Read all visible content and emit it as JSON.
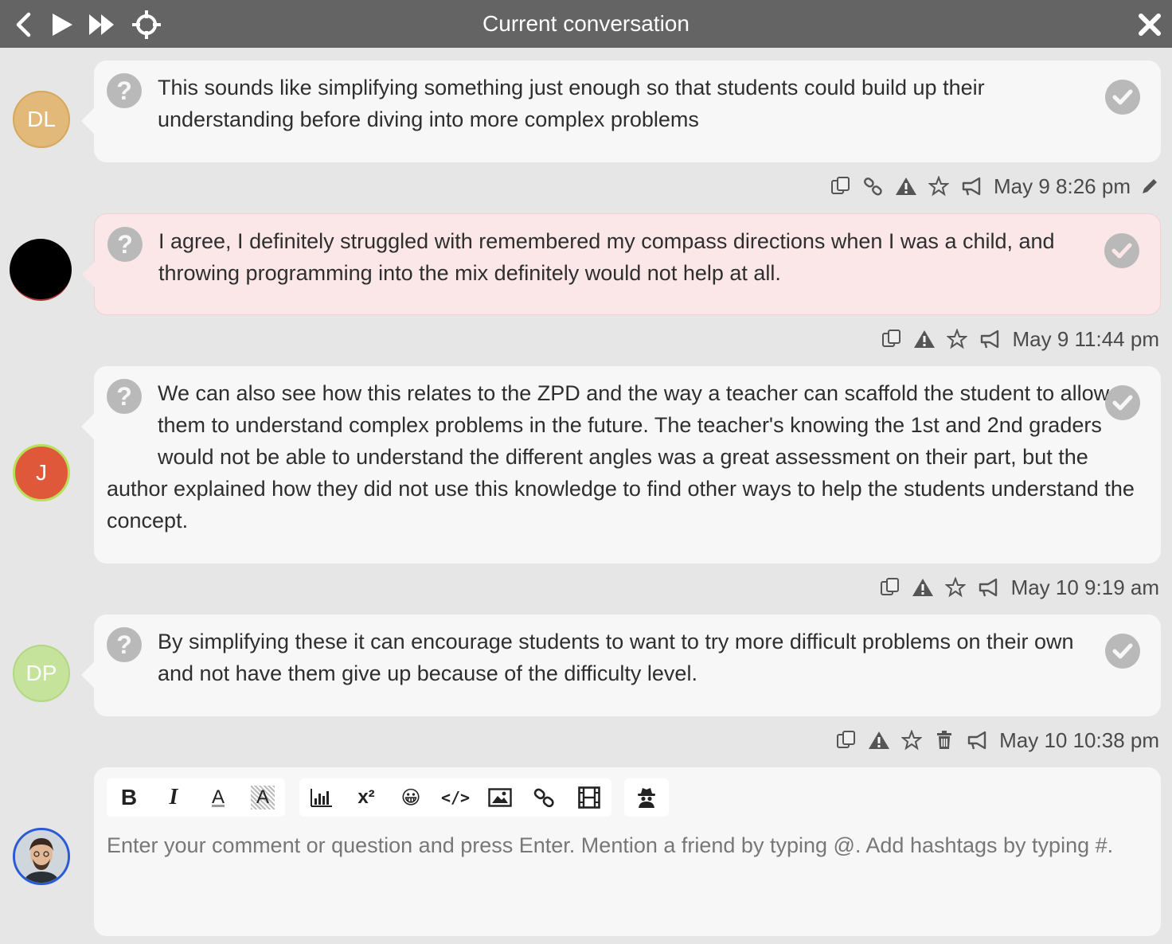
{
  "header": {
    "title": "Current conversation",
    "back_icon": "chevron-left-icon",
    "play_icon": "play-icon",
    "fast_forward_icon": "fast-forward-icon",
    "locate_icon": "crosshair-icon",
    "close_icon": "close-icon"
  },
  "comments": [
    {
      "avatar_initials": "DL",
      "avatar_color": "#e2b978",
      "text": "This sounds like simplifying something just enough so that students could build up their understanding before diving into more complex problems",
      "timestamp": "May 9 8:26 pm",
      "highlighted": false
    },
    {
      "avatar_initials": "",
      "avatar_color": "#000000",
      "text": "I agree, I definitely struggled with remembered my compass directions when I was a child, and throwing programming into the mix definitely would not help at all.",
      "timestamp": "May 9 11:44 pm",
      "highlighted": true
    },
    {
      "avatar_initials": "J",
      "avatar_color": "#e0583a",
      "text": "We can also see how this relates to the ZPD and the way a teacher can scaffold the student to allow them to understand complex problems in the future. The teacher's knowing the 1st and 2nd graders would not be able to understand the different angles was a great assessment on their part, but the author explained how they did not use this knowledge to find other ways to help the students understand the concept.",
      "timestamp": "May 10 9:19 am",
      "highlighted": false
    },
    {
      "avatar_initials": "DP",
      "avatar_color": "#c5e39a",
      "text": "By simplifying these it can encourage students to want to try more difficult problems on their own and not have them give up because of the difficulty level.",
      "timestamp": "May 10 10:38 pm",
      "highlighted": false
    }
  ],
  "composer": {
    "placeholder": "Enter your comment or question and press Enter. Mention a friend by typing @. Add hashtags by typing #.",
    "tools": {
      "bold": "B",
      "italic": "I",
      "font_color": "A",
      "highlight": "A",
      "chart": "chart-icon",
      "superscript": "x²",
      "emoji": "😀",
      "code": "</>",
      "image": "image-icon",
      "link": "link-icon",
      "video": "film-icon",
      "anonymous": "spy-icon"
    }
  }
}
